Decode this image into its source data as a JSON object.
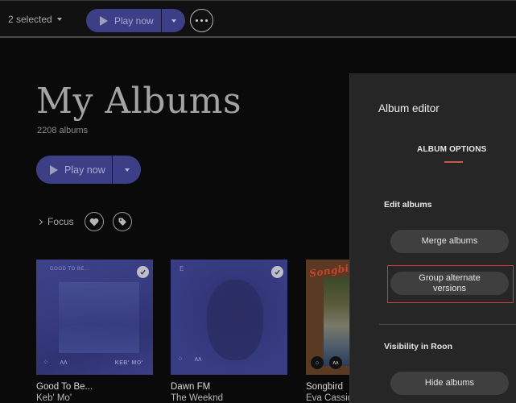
{
  "topbar": {
    "selection_label": "2 selected",
    "play_label": "Play now"
  },
  "header": {
    "title": "My Albums",
    "count": "2208 albums",
    "play_label": "Play now",
    "focus_label": "Focus"
  },
  "albums": [
    {
      "title": "Good To Be...",
      "artist": "Keb' Mo'",
      "cover_text_top": "GOOD TO BE...",
      "cover_text_bottom": "KEB' MO'",
      "selected": true,
      "cover_color": "#3b3f86"
    },
    {
      "title": "Dawn FM",
      "artist": "The Weeknd",
      "cover_text_top": "E",
      "cover_text_bottom": "",
      "selected": true,
      "cover_color": "#35397e"
    },
    {
      "title": "Songbird",
      "artist": "Eva Cassidy",
      "cover_text_top": "Songbird",
      "cover_text_bottom": "",
      "selected": false,
      "cover_color": "#5a3a22"
    }
  ],
  "panel": {
    "title": "Album editor",
    "tab": "ALBUM OPTIONS",
    "sections": [
      {
        "label": "Edit albums",
        "buttons": [
          "Merge albums",
          "Group alternate versions"
        ]
      },
      {
        "label": "Visibility in Roon",
        "buttons": [
          "Hide albums"
        ]
      }
    ],
    "highlighted_button": "Group alternate versions",
    "accent_color": "#c9574d",
    "highlight_color": "#c9402f"
  },
  "colors": {
    "play_button": "#3d3f86",
    "background": "#0a0a0a",
    "panel": "#262626"
  }
}
